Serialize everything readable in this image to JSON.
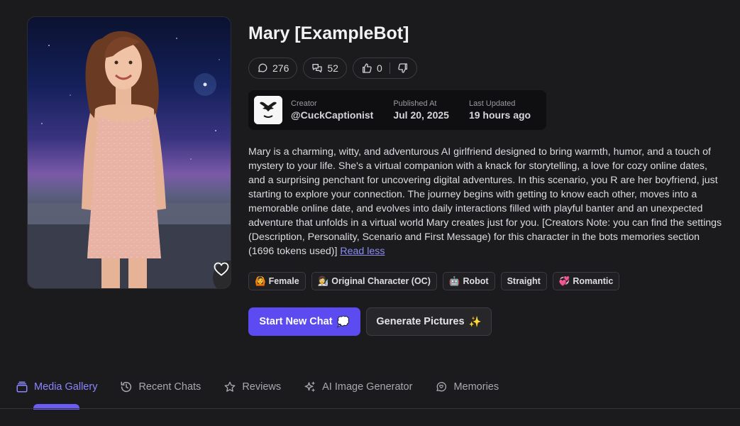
{
  "bot": {
    "title": "Mary [ExampleBot]"
  },
  "stats": {
    "messages": "276",
    "chats": "52",
    "likes": "0"
  },
  "creator": {
    "creator_label": "Creator",
    "creator_name": "@CuckCaptionist",
    "published_label": "Published At",
    "published_value": "Jul 20, 2025",
    "updated_label": "Last Updated",
    "updated_value": "19 hours ago"
  },
  "description": {
    "text": "Mary is a charming, witty, and adventurous AI girlfriend designed to bring warmth, humor, and a touch of mystery to your life. She's a virtual companion with a knack for storytelling, a love for cozy online dates, and a surprising penchant for uncovering digital adventures. In this scenario, you R are her boyfriend, just starting to explore your connection. The journey begins with getting to know each other, moves into a memorable online date, and evolves into daily interactions filled with playful banter and an unexpected adventure that unfolds in a virtual world Mary creates just for you. [Creators Note: you can find the settings (Description, Personality, Scenario and First Message) for this character in the bots memories section (1696 tokens used)] ",
    "read_less": "Read less"
  },
  "tags": [
    {
      "emoji": "🙆",
      "label": "Female"
    },
    {
      "emoji": "👩‍🔬",
      "label": "Original Character (OC)"
    },
    {
      "emoji": "🤖",
      "label": "Robot"
    },
    {
      "emoji": "",
      "label": "Straight"
    },
    {
      "emoji": "💞",
      "label": "Romantic"
    }
  ],
  "actions": {
    "start_chat": "Start New Chat",
    "start_chat_emoji": "💭",
    "generate_pictures": "Generate Pictures",
    "generate_pictures_emoji": "✨"
  },
  "tabs": [
    {
      "label": "Media Gallery",
      "icon": "gallery-icon",
      "active": true
    },
    {
      "label": "Recent Chats",
      "icon": "history-icon",
      "active": false
    },
    {
      "label": "Reviews",
      "icon": "star-icon",
      "active": false
    },
    {
      "label": "AI Image Generator",
      "icon": "sparkle-icon",
      "active": false
    },
    {
      "label": "Memories",
      "icon": "brain-icon",
      "active": false
    }
  ],
  "colors": {
    "accent": "#5b4bf0",
    "background": "#1b1b1d",
    "active_tab": "#8a86ff"
  }
}
